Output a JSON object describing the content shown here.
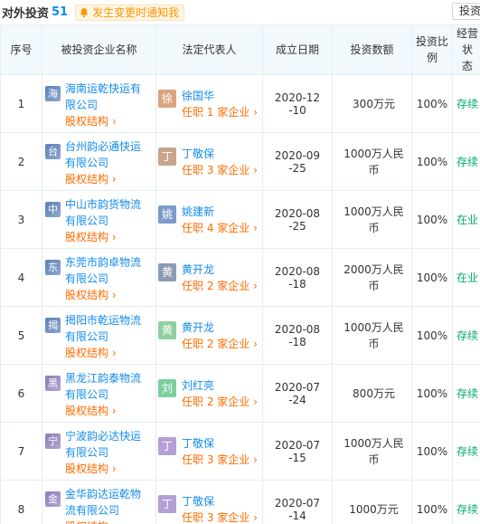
{
  "header": {
    "title": "对外投资",
    "count": "51",
    "notify_label": "发生变更时通知我",
    "invest_label": "投资"
  },
  "columns": [
    "序号",
    "被投资企业名称",
    "法定代表人",
    "成立日期",
    "投资数额",
    "投资比例",
    "经营状态"
  ],
  "equity_label": "股权结构 ›",
  "rows": [
    {
      "index": "1",
      "logo_char": "海",
      "company_line1": "海南运乾快运有",
      "company_line2": "限公司",
      "avatar_char": "徐",
      "avatar_color": "#d9a37e",
      "rep_name": "徐国华",
      "rep_role": "任职 1 家企业 ›",
      "date_line1": "2020-12",
      "date_line2": "-10",
      "amount_line1": "300万元",
      "amount_line2": "",
      "ratio": "100%",
      "status": "存续"
    },
    {
      "index": "2",
      "logo_char": "台",
      "company_line1": "台州韵必通快运",
      "company_line2": "有限公司",
      "avatar_char": "丁",
      "avatar_color": "#c9a48a",
      "rep_name": "丁敬保",
      "rep_role": "任职 3 家企业 ›",
      "date_line1": "2020-09",
      "date_line2": "-25",
      "amount_line1": "1000万人民",
      "amount_line2": "币",
      "ratio": "100%",
      "status": "存续"
    },
    {
      "index": "3",
      "logo_char": "中",
      "company_line1": "中山市韵货物流",
      "company_line2": "有限公司",
      "avatar_char": "姚",
      "avatar_color": "#7d9bc9",
      "rep_name": "姚建新",
      "rep_role": "任职 4 家企业 ›",
      "date_line1": "2020-08",
      "date_line2": "-25",
      "amount_line1": "1000万人民",
      "amount_line2": "币",
      "ratio": "100%",
      "status": "在业"
    },
    {
      "index": "4",
      "logo_char": "东",
      "company_line1": "东莞市韵卓物流",
      "company_line2": "有限公司",
      "avatar_char": "黄",
      "avatar_color": "#8c9bb5",
      "rep_name": "黄开龙",
      "rep_role": "任职 2 家企业 ›",
      "date_line1": "2020-08",
      "date_line2": "-18",
      "amount_line1": "2000万人民",
      "amount_line2": "币",
      "ratio": "100%",
      "status": "在业"
    },
    {
      "index": "5",
      "logo_char": "揭",
      "company_line1": "揭阳市乾运物流",
      "company_line2": "有限公司",
      "avatar_char": "黄",
      "avatar_color": "#8fcfa0",
      "rep_name": "黄开龙",
      "rep_role": "任职 2 家企业 ›",
      "date_line1": "2020-08",
      "date_line2": "-18",
      "amount_line1": "1000万人民",
      "amount_line2": "币",
      "ratio": "100%",
      "status": "存续"
    },
    {
      "index": "6",
      "logo_char": "黑",
      "company_line1": "黑龙江韵泰物流",
      "company_line2": "有限公司",
      "avatar_char": "刘",
      "avatar_color": "#7ccf9d",
      "rep_name": "刘红亮",
      "rep_role": "任职 2 家企业 ›",
      "date_line1": "2020-07",
      "date_line2": "-24",
      "amount_line1": "800万元",
      "amount_line2": "",
      "ratio": "100%",
      "status": "存续"
    },
    {
      "index": "7",
      "logo_char": "宁",
      "company_line1": "宁波韵必达快运",
      "company_line2": "有限公司",
      "avatar_char": "丁",
      "avatar_color": "#b59fd6",
      "rep_name": "丁敬保",
      "rep_role": "任职 3 家企业 ›",
      "date_line1": "2020-07",
      "date_line2": "-15",
      "amount_line1": "1000万人民",
      "amount_line2": "币",
      "ratio": "100%",
      "status": "存续"
    },
    {
      "index": "8",
      "logo_char": "金",
      "company_line1": "金华韵达运乾物",
      "company_line2": "流有限公司",
      "avatar_char": "丁",
      "avatar_color": "#b59fd6",
      "rep_name": "丁敬保",
      "rep_role": "任职 3 家企业 ›",
      "date_line1": "2020-07",
      "date_line2": "-14",
      "amount_line1": "1000万元",
      "amount_line2": "",
      "ratio": "100%",
      "status": "存续"
    }
  ]
}
